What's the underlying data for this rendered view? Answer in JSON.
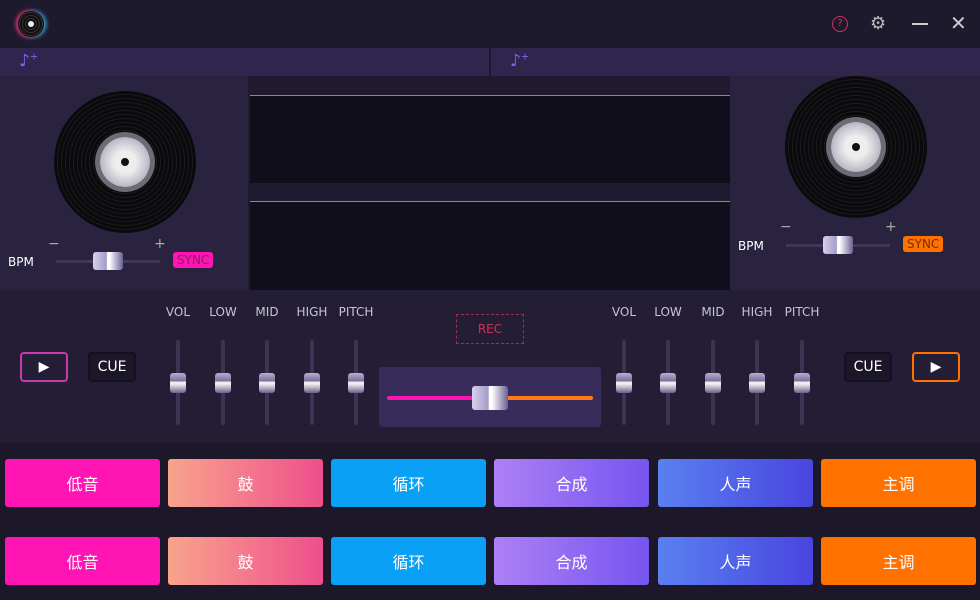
{
  "window": {
    "help_icon": "question-circle-icon",
    "settings_icon": "gear-icon",
    "minimize_icon": "minus-icon",
    "close_icon": "x-icon"
  },
  "left_deck": {
    "add_music_icon": "music-plus-icon",
    "bpm_label": "BPM",
    "minus": "−",
    "plus": "+",
    "sync_label": "SYNC",
    "sync_color": "#ff14b4",
    "bpm_slider": 0.45,
    "play_icon": "play-icon",
    "cue_label": "CUE"
  },
  "right_deck": {
    "add_music_icon": "music-plus-icon",
    "bpm_label": "BPM",
    "minus": "−",
    "plus": "+",
    "sync_label": "SYNC",
    "sync_color": "#ff7200",
    "bpm_slider": 0.45,
    "play_icon": "play-icon",
    "cue_label": "CUE"
  },
  "mixer": {
    "left_faders": [
      {
        "label": "VOL",
        "value": 0.5
      },
      {
        "label": "LOW",
        "value": 0.5
      },
      {
        "label": "MID",
        "value": 0.5
      },
      {
        "label": "HIGH",
        "value": 0.5
      },
      {
        "label": "PITCH",
        "value": 0.5
      }
    ],
    "right_faders": [
      {
        "label": "VOL",
        "value": 0.5
      },
      {
        "label": "LOW",
        "value": 0.5
      },
      {
        "label": "MID",
        "value": 0.5
      },
      {
        "label": "HIGH",
        "value": 0.5
      },
      {
        "label": "PITCH",
        "value": 0.5
      }
    ],
    "rec_label": "REC",
    "crossfader": 0.45
  },
  "pads": {
    "rows": [
      [
        {
          "label": "低音",
          "color": "#ff14b4"
        },
        {
          "label": "鼓",
          "color": "linear-gradient(90deg,#f9a38c,#ee4f8b)"
        },
        {
          "label": "循环",
          "color": "#0aa0f5"
        },
        {
          "label": "合成",
          "color": "linear-gradient(90deg,#ad80f6,#7655ef)"
        },
        {
          "label": "人声",
          "color": "linear-gradient(90deg,#5a80f0,#4845e0)"
        },
        {
          "label": "主调",
          "color": "#ff7200"
        }
      ],
      [
        {
          "label": "低音",
          "color": "#ff14b4"
        },
        {
          "label": "鼓",
          "color": "linear-gradient(90deg,#f9a38c,#ee4f8b)"
        },
        {
          "label": "循环",
          "color": "#0aa0f5"
        },
        {
          "label": "合成",
          "color": "linear-gradient(90deg,#ad80f6,#7655ef)"
        },
        {
          "label": "人声",
          "color": "linear-gradient(90deg,#5a80f0,#4845e0)"
        },
        {
          "label": "主调",
          "color": "#ff7200"
        }
      ]
    ]
  }
}
